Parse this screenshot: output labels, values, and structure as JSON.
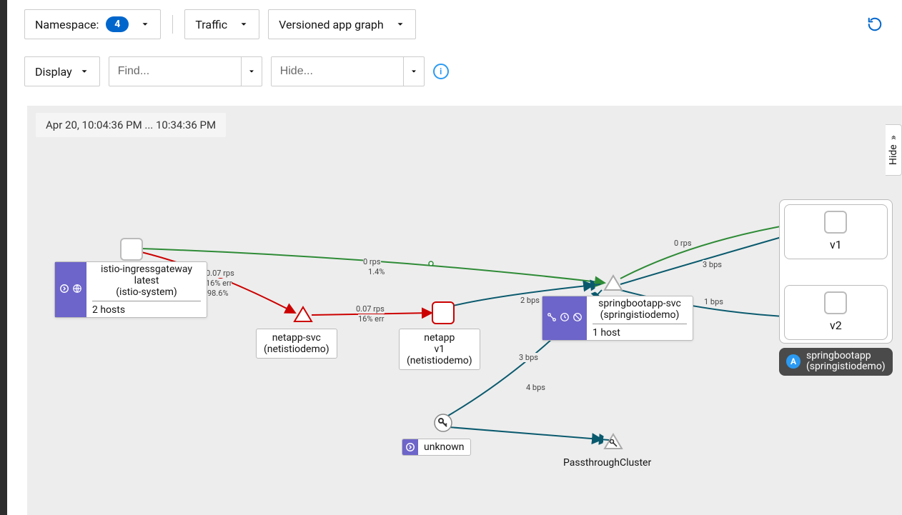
{
  "toolbar": {
    "namespace_label": "Namespace:",
    "namespace_count": "4",
    "traffic_label": "Traffic",
    "graph_type_label": "Versioned app graph",
    "history_icon": "history-icon"
  },
  "filterbar": {
    "display_label": "Display",
    "find_placeholder": "Find...",
    "hide_placeholder": "Hide...",
    "help_icon": "info"
  },
  "canvas": {
    "time_range": "Apr 20, 10:04:36 PM ... 10:34:36 PM",
    "hide_panel_label": "Hide"
  },
  "nodes": {
    "ingress": {
      "title": "istio-ingressgateway",
      "version": "latest",
      "namespace": "(istio-system)",
      "hosts": "2 hosts"
    },
    "netapp_svc": {
      "title": "netapp-svc",
      "namespace": "(netistiodemo)"
    },
    "netapp": {
      "title": "netapp",
      "version": "v1",
      "namespace": "(netistiodemo)"
    },
    "springboot_svc": {
      "title": "springbootapp-svc",
      "namespace": "(springistiodemo)",
      "hosts": "1 host"
    },
    "springboot": {
      "title": "springbootapp",
      "namespace": "(springistiodemo)",
      "v1": "v1",
      "v2": "v2"
    },
    "unknown": {
      "label": "unknown"
    },
    "passthrough": {
      "label": "PassthroughCluster"
    }
  },
  "edge_labels": {
    "ingress_to_svc": {
      "top": "0 rps",
      "bot": "1.4%"
    },
    "ingress_right_1": "0.07 rps",
    "ingress_right_2": "16% err",
    "ingress_right_3": "98.6%",
    "netsvc_to_netapp": {
      "top": "0.07 rps",
      "bot": "16% err"
    },
    "netapp_to_svc": "2 bps",
    "unknown_to_svc": "3 bps",
    "unknown_to_pt": "4 bps",
    "svc_to_v1_a": "0 rps",
    "svc_to_v1_b": "3 bps",
    "svc_to_v2": "1 bps"
  },
  "chart_data": {
    "type": "graph",
    "nodes": [
      {
        "id": "ingress",
        "label": "istio-ingressgateway",
        "ns": "istio-system",
        "version": "latest",
        "hosts": 2
      },
      {
        "id": "netapp-svc",
        "label": "netapp-svc",
        "ns": "netistiodemo",
        "kind": "service"
      },
      {
        "id": "netapp-v1",
        "label": "netapp",
        "ns": "netistiodemo",
        "version": "v1"
      },
      {
        "id": "springboot-svc",
        "label": "springbootapp-svc",
        "ns": "springistiodemo",
        "kind": "service",
        "hosts": 1
      },
      {
        "id": "springboot-v1",
        "label": "springbootapp",
        "ns": "springistiodemo",
        "version": "v1"
      },
      {
        "id": "springboot-v2",
        "label": "springbootapp",
        "ns": "springistiodemo",
        "version": "v2"
      },
      {
        "id": "unknown",
        "label": "unknown"
      },
      {
        "id": "passthrough",
        "label": "PassthroughCluster"
      }
    ],
    "edges": [
      {
        "from": "ingress",
        "to": "springboot-svc",
        "rps": 0,
        "pct_ok": 1.4,
        "color": "green"
      },
      {
        "from": "ingress",
        "to": "netapp-svc",
        "rps": 0.07,
        "err_pct": 16,
        "pct_ok": 98.6,
        "color": "red"
      },
      {
        "from": "netapp-svc",
        "to": "netapp-v1",
        "rps": 0.07,
        "err_pct": 16,
        "color": "red"
      },
      {
        "from": "netapp-v1",
        "to": "springboot-svc",
        "bps": 2,
        "color": "teal"
      },
      {
        "from": "unknown",
        "to": "springboot-svc",
        "bps": 3,
        "color": "teal"
      },
      {
        "from": "unknown",
        "to": "passthrough",
        "bps": 4,
        "color": "teal"
      },
      {
        "from": "springboot-svc",
        "to": "springboot-v1",
        "rps": 0,
        "color": "green"
      },
      {
        "from": "springboot-svc",
        "to": "springboot-v1",
        "bps": 3,
        "color": "teal"
      },
      {
        "from": "springboot-svc",
        "to": "springboot-v2",
        "bps": 1,
        "color": "teal"
      }
    ]
  }
}
